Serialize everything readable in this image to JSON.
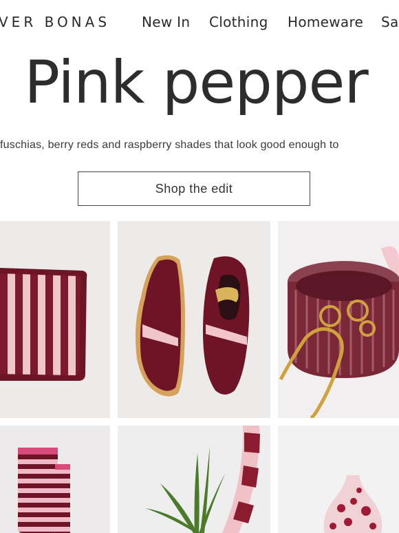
{
  "header": {
    "logo_text": "VER BONAS",
    "nav_items": [
      "New In",
      "Clothing",
      "Homeware",
      "Sa"
    ]
  },
  "hero": {
    "title": "Pink pepper",
    "subtitle": "fuschias, berry reds and raspberry shades that look good enough to",
    "cta_label": "Shop the edit"
  },
  "colors": {
    "berry": "#6b1426",
    "pink": "#f2c4c8",
    "tile_bg": "#ece9e8"
  },
  "products": [
    {
      "image": "striped-cushion"
    },
    {
      "image": "burgundy-trainers"
    },
    {
      "image": "glass-jewellery-dish"
    },
    {
      "image": "striped-socks"
    },
    {
      "image": "striped-mirror-with-plant"
    },
    {
      "image": "spotted-glass-vase"
    }
  ]
}
